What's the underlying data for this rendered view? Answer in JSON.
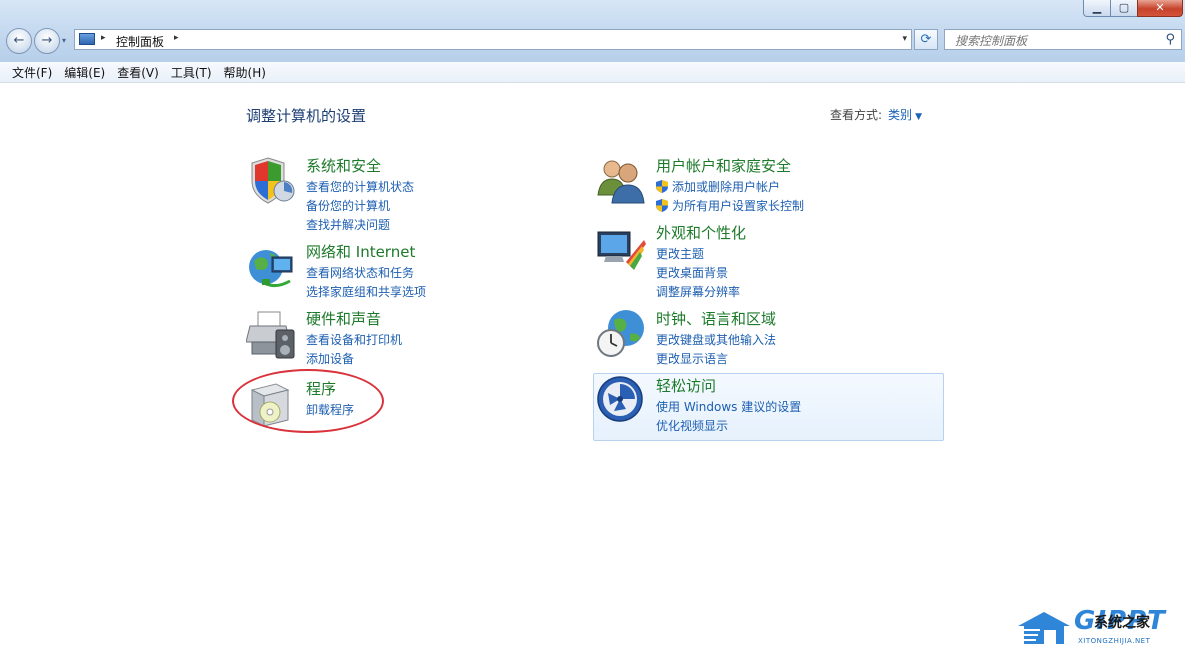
{
  "window": {
    "minimize_glyph": "▁",
    "maximize_glyph": "▢",
    "close_glyph": "✕"
  },
  "nav": {
    "back_glyph": "←",
    "forward_glyph": "→",
    "dropdown_glyph": "▾"
  },
  "address": {
    "sep": "▸",
    "crumb": "控制面板",
    "dropdown_glyph": "▾",
    "refresh_glyph": "⟳"
  },
  "search": {
    "placeholder": "搜索控制面板",
    "icon_glyph": "⚲"
  },
  "menu": [
    "文件(F)",
    "编辑(E)",
    "查看(V)",
    "工具(T)",
    "帮助(H)"
  ],
  "main": {
    "title": "调整计算机的设置",
    "view_by_label": "查看方式:",
    "view_by_value": "类别",
    "view_by_arrow": "▼"
  },
  "categories": {
    "security": {
      "title": "系统和安全",
      "links": [
        "查看您的计算机状态",
        "备份您的计算机",
        "查找并解决问题"
      ]
    },
    "network": {
      "title": "网络和 Internet",
      "links": [
        "查看网络状态和任务",
        "选择家庭组和共享选项"
      ]
    },
    "hardware": {
      "title": "硬件和声音",
      "links": [
        "查看设备和打印机",
        "添加设备"
      ]
    },
    "programs": {
      "title": "程序",
      "links": [
        "卸载程序"
      ]
    },
    "users": {
      "title": "用户帐户和家庭安全",
      "links": [
        "添加或删除用户帐户",
        "为所有用户设置家长控制"
      ]
    },
    "appearance": {
      "title": "外观和个性化",
      "links": [
        "更改主题",
        "更改桌面背景",
        "调整屏幕分辨率"
      ]
    },
    "clock": {
      "title": "时钟、语言和区域",
      "links": [
        "更改键盘或其他输入法",
        "更改显示语言"
      ]
    },
    "ease": {
      "title": "轻松访问",
      "links": [
        "使用 Windows 建议的设置",
        "优化视频显示"
      ]
    }
  },
  "watermark": {
    "main": "GIPPT",
    "cn": "系统之家",
    "sub": "XITONGZHIJIA.NET"
  },
  "colors": {
    "category_title": "#1c7a2a",
    "link": "#1d5fb1",
    "page_title": "#1e3f74",
    "annotation_circle": "#d9323a"
  }
}
